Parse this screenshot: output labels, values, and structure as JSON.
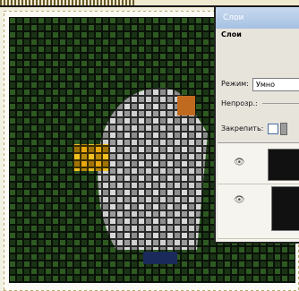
{
  "window": {
    "title": "Слои"
  },
  "panel": {
    "tab_label": "Слои",
    "mode_label": "Режим:",
    "mode_value": "Умно",
    "opacity_label": "Непрозр.:",
    "lock_label": "Закрепить:"
  },
  "layers": [
    {
      "visibility_icon": "eye-icon"
    },
    {
      "visibility_icon": "eye-icon"
    }
  ],
  "colors": {
    "title_bar": "#a7c0e2",
    "panel_bg": "#e7e4dc",
    "canvas_bg": "#0b1408"
  }
}
